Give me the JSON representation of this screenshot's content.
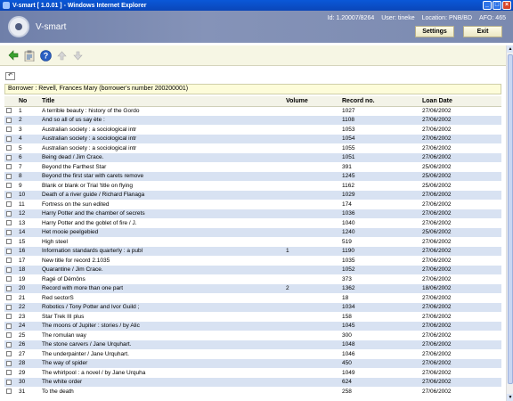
{
  "window": {
    "title": "V-smart [ 1.0.01 ] - Windows Internet Explorer"
  },
  "header": {
    "logo_text": "V-smart",
    "id_label": "Id: 1.20007/8264",
    "user_label": "User: tineke",
    "location_label": "Location: PNB/BD",
    "afo_label": "AFO: 465",
    "settings_label": "Settings",
    "exit_label": "Exit"
  },
  "borrower_line": "Borrower : Revell, Frances Mary (borrower's number 200200001)",
  "table": {
    "columns": [
      "No",
      "Title",
      "Volume",
      "Record no.",
      "Loan Date"
    ],
    "rows": [
      {
        "no": "1",
        "title": "A terrible beauty : history of the Gordo",
        "volume": "",
        "record": "1027",
        "date": "27/06/2002"
      },
      {
        "no": "2",
        "title": "And so all of us say ète :",
        "volume": "",
        "record": "1108",
        "date": "27/06/2002"
      },
      {
        "no": "3",
        "title": "Australian society : a sociological intr",
        "volume": "",
        "record": "1053",
        "date": "27/06/2002"
      },
      {
        "no": "4",
        "title": "Australian society : a sociological intr",
        "volume": "",
        "record": "1054",
        "date": "27/06/2002"
      },
      {
        "no": "5",
        "title": "Australian society : a sociological intr",
        "volume": "",
        "record": "1055",
        "date": "27/06/2002"
      },
      {
        "no": "6",
        "title": "Being dead / Jim Crace.",
        "volume": "",
        "record": "1051",
        "date": "27/06/2002"
      },
      {
        "no": "7",
        "title": "Beyond the Farthest Star",
        "volume": "",
        "record": "391",
        "date": "25/06/2002"
      },
      {
        "no": "8",
        "title": "Beyond the first star with carets remove",
        "volume": "",
        "record": "1245",
        "date": "25/06/2002"
      },
      {
        "no": "9",
        "title": "Blank or blank or Trial 'title on flying",
        "volume": "",
        "record": "1162",
        "date": "25/06/2002"
      },
      {
        "no": "10",
        "title": "Death of a river guide / Richard Flanaga",
        "volume": "",
        "record": "1029",
        "date": "27/06/2002"
      },
      {
        "no": "11",
        "title": "Fortress on the sun edited",
        "volume": "",
        "record": "174",
        "date": "27/06/2002"
      },
      {
        "no": "12",
        "title": "Harry Potter and the chamber of secrets",
        "volume": "",
        "record": "1036",
        "date": "27/06/2002"
      },
      {
        "no": "13",
        "title": "Harry Potter and the goblet of fire / J.",
        "volume": "",
        "record": "1040",
        "date": "27/06/2002"
      },
      {
        "no": "14",
        "title": "Het mooie peelgebied",
        "volume": "",
        "record": "1240",
        "date": "25/06/2002"
      },
      {
        "no": "15",
        "title": "High steel",
        "volume": "",
        "record": "519",
        "date": "27/06/2002"
      },
      {
        "no": "16",
        "title": "Information standards quarterly : a publ",
        "volume": "1",
        "record": "1190",
        "date": "27/06/2002"
      },
      {
        "no": "17",
        "title": "New title for record 2.1035",
        "volume": "",
        "record": "1035",
        "date": "27/06/2002"
      },
      {
        "no": "18",
        "title": "Quarantine / Jim Crace.",
        "volume": "",
        "record": "1052",
        "date": "27/06/2002"
      },
      {
        "no": "19",
        "title": "Ragé of Démôns",
        "volume": "",
        "record": "373",
        "date": "27/06/2002"
      },
      {
        "no": "20",
        "title": "Record with more than one part",
        "volume": "2",
        "record": "1362",
        "date": "18/06/2002"
      },
      {
        "no": "21",
        "title": "Red sectorS",
        "volume": "",
        "record": "18",
        "date": "27/06/2002"
      },
      {
        "no": "22",
        "title": "Robotics / Tony Potter and Ivor Guild ;",
        "volume": "",
        "record": "1034",
        "date": "27/06/2002"
      },
      {
        "no": "23",
        "title": "Star Trek III plus",
        "volume": "",
        "record": "158",
        "date": "27/06/2002"
      },
      {
        "no": "24",
        "title": "The moons of Jupiter : stories / by Alic",
        "volume": "",
        "record": "1045",
        "date": "27/06/2002"
      },
      {
        "no": "25",
        "title": "The romulan way",
        "volume": "",
        "record": "300",
        "date": "27/06/2002"
      },
      {
        "no": "26",
        "title": "The stone carvers / Jane Urquhart.",
        "volume": "",
        "record": "1048",
        "date": "27/06/2002"
      },
      {
        "no": "27",
        "title": "The underpainter / Jane Urquhart.",
        "volume": "",
        "record": "1046",
        "date": "27/06/2002"
      },
      {
        "no": "28",
        "title": "The way of spider",
        "volume": "",
        "record": "450",
        "date": "27/06/2002"
      },
      {
        "no": "29",
        "title": "The whirlpool : a novel / by Jane Urquha",
        "volume": "",
        "record": "1049",
        "date": "27/06/2002"
      },
      {
        "no": "30",
        "title": "The white order",
        "volume": "",
        "record": "624",
        "date": "27/06/2002"
      },
      {
        "no": "31",
        "title": "To the death",
        "volume": "",
        "record": "258",
        "date": "27/06/2002"
      }
    ]
  },
  "icons": {
    "toolbar": [
      "back-arrow-icon",
      "clipboard-icon",
      "help-icon",
      "up-arrow-icon",
      "down-arrow-icon"
    ],
    "title_bar_buttons": [
      "minimize",
      "maximize",
      "close"
    ]
  },
  "colors": {
    "header_bg": "#7b8ab0",
    "row_stripe": "#d8e2f2",
    "borrower_bg": "#fdfcd9",
    "toolbar_bg": "#f6f6e4"
  }
}
